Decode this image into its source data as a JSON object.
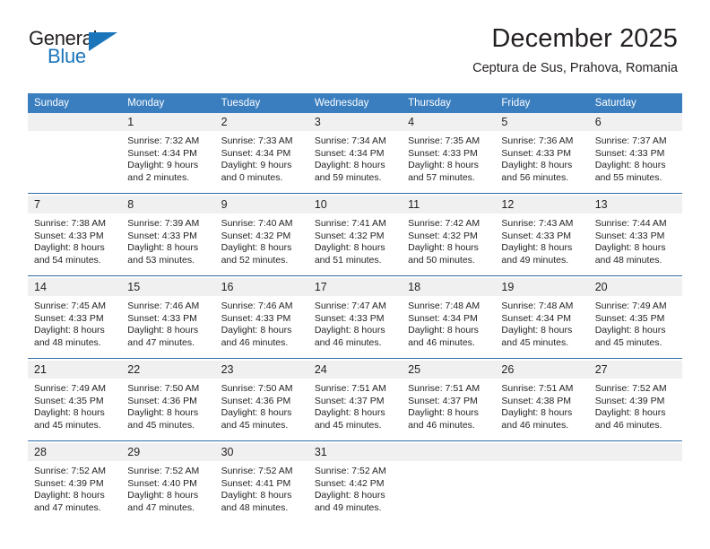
{
  "logo": {
    "word_top": "General",
    "word_bottom": "Blue",
    "triangle_icon": "triangle-icon",
    "brand_color": "#1b75bb"
  },
  "header": {
    "title": "December 2025",
    "subtitle": "Ceptura de Sus, Prahova, Romania"
  },
  "colors": {
    "header_row_bg": "#3a7ebf",
    "header_row_text": "#ffffff",
    "daynum_bg": "#f0f0f0",
    "week_separator": "#2f6da8",
    "body_text": "#231f20"
  },
  "weekday_headers": [
    "Sunday",
    "Monday",
    "Tuesday",
    "Wednesday",
    "Thursday",
    "Friday",
    "Saturday"
  ],
  "weeks": [
    [
      {
        "day": "",
        "sunrise": "",
        "sunset": "",
        "daylight_line1": "",
        "daylight_line2": "",
        "empty": true
      },
      {
        "day": "1",
        "sunrise": "Sunrise: 7:32 AM",
        "sunset": "Sunset: 4:34 PM",
        "daylight_line1": "Daylight: 9 hours",
        "daylight_line2": "and 2 minutes."
      },
      {
        "day": "2",
        "sunrise": "Sunrise: 7:33 AM",
        "sunset": "Sunset: 4:34 PM",
        "daylight_line1": "Daylight: 9 hours",
        "daylight_line2": "and 0 minutes."
      },
      {
        "day": "3",
        "sunrise": "Sunrise: 7:34 AM",
        "sunset": "Sunset: 4:34 PM",
        "daylight_line1": "Daylight: 8 hours",
        "daylight_line2": "and 59 minutes."
      },
      {
        "day": "4",
        "sunrise": "Sunrise: 7:35 AM",
        "sunset": "Sunset: 4:33 PM",
        "daylight_line1": "Daylight: 8 hours",
        "daylight_line2": "and 57 minutes."
      },
      {
        "day": "5",
        "sunrise": "Sunrise: 7:36 AM",
        "sunset": "Sunset: 4:33 PM",
        "daylight_line1": "Daylight: 8 hours",
        "daylight_line2": "and 56 minutes."
      },
      {
        "day": "6",
        "sunrise": "Sunrise: 7:37 AM",
        "sunset": "Sunset: 4:33 PM",
        "daylight_line1": "Daylight: 8 hours",
        "daylight_line2": "and 55 minutes."
      }
    ],
    [
      {
        "day": "7",
        "sunrise": "Sunrise: 7:38 AM",
        "sunset": "Sunset: 4:33 PM",
        "daylight_line1": "Daylight: 8 hours",
        "daylight_line2": "and 54 minutes."
      },
      {
        "day": "8",
        "sunrise": "Sunrise: 7:39 AM",
        "sunset": "Sunset: 4:33 PM",
        "daylight_line1": "Daylight: 8 hours",
        "daylight_line2": "and 53 minutes."
      },
      {
        "day": "9",
        "sunrise": "Sunrise: 7:40 AM",
        "sunset": "Sunset: 4:32 PM",
        "daylight_line1": "Daylight: 8 hours",
        "daylight_line2": "and 52 minutes."
      },
      {
        "day": "10",
        "sunrise": "Sunrise: 7:41 AM",
        "sunset": "Sunset: 4:32 PM",
        "daylight_line1": "Daylight: 8 hours",
        "daylight_line2": "and 51 minutes."
      },
      {
        "day": "11",
        "sunrise": "Sunrise: 7:42 AM",
        "sunset": "Sunset: 4:32 PM",
        "daylight_line1": "Daylight: 8 hours",
        "daylight_line2": "and 50 minutes."
      },
      {
        "day": "12",
        "sunrise": "Sunrise: 7:43 AM",
        "sunset": "Sunset: 4:33 PM",
        "daylight_line1": "Daylight: 8 hours",
        "daylight_line2": "and 49 minutes."
      },
      {
        "day": "13",
        "sunrise": "Sunrise: 7:44 AM",
        "sunset": "Sunset: 4:33 PM",
        "daylight_line1": "Daylight: 8 hours",
        "daylight_line2": "and 48 minutes."
      }
    ],
    [
      {
        "day": "14",
        "sunrise": "Sunrise: 7:45 AM",
        "sunset": "Sunset: 4:33 PM",
        "daylight_line1": "Daylight: 8 hours",
        "daylight_line2": "and 48 minutes."
      },
      {
        "day": "15",
        "sunrise": "Sunrise: 7:46 AM",
        "sunset": "Sunset: 4:33 PM",
        "daylight_line1": "Daylight: 8 hours",
        "daylight_line2": "and 47 minutes."
      },
      {
        "day": "16",
        "sunrise": "Sunrise: 7:46 AM",
        "sunset": "Sunset: 4:33 PM",
        "daylight_line1": "Daylight: 8 hours",
        "daylight_line2": "and 46 minutes."
      },
      {
        "day": "17",
        "sunrise": "Sunrise: 7:47 AM",
        "sunset": "Sunset: 4:33 PM",
        "daylight_line1": "Daylight: 8 hours",
        "daylight_line2": "and 46 minutes."
      },
      {
        "day": "18",
        "sunrise": "Sunrise: 7:48 AM",
        "sunset": "Sunset: 4:34 PM",
        "daylight_line1": "Daylight: 8 hours",
        "daylight_line2": "and 46 minutes."
      },
      {
        "day": "19",
        "sunrise": "Sunrise: 7:48 AM",
        "sunset": "Sunset: 4:34 PM",
        "daylight_line1": "Daylight: 8 hours",
        "daylight_line2": "and 45 minutes."
      },
      {
        "day": "20",
        "sunrise": "Sunrise: 7:49 AM",
        "sunset": "Sunset: 4:35 PM",
        "daylight_line1": "Daylight: 8 hours",
        "daylight_line2": "and 45 minutes."
      }
    ],
    [
      {
        "day": "21",
        "sunrise": "Sunrise: 7:49 AM",
        "sunset": "Sunset: 4:35 PM",
        "daylight_line1": "Daylight: 8 hours",
        "daylight_line2": "and 45 minutes."
      },
      {
        "day": "22",
        "sunrise": "Sunrise: 7:50 AM",
        "sunset": "Sunset: 4:36 PM",
        "daylight_line1": "Daylight: 8 hours",
        "daylight_line2": "and 45 minutes."
      },
      {
        "day": "23",
        "sunrise": "Sunrise: 7:50 AM",
        "sunset": "Sunset: 4:36 PM",
        "daylight_line1": "Daylight: 8 hours",
        "daylight_line2": "and 45 minutes."
      },
      {
        "day": "24",
        "sunrise": "Sunrise: 7:51 AM",
        "sunset": "Sunset: 4:37 PM",
        "daylight_line1": "Daylight: 8 hours",
        "daylight_line2": "and 45 minutes."
      },
      {
        "day": "25",
        "sunrise": "Sunrise: 7:51 AM",
        "sunset": "Sunset: 4:37 PM",
        "daylight_line1": "Daylight: 8 hours",
        "daylight_line2": "and 46 minutes."
      },
      {
        "day": "26",
        "sunrise": "Sunrise: 7:51 AM",
        "sunset": "Sunset: 4:38 PM",
        "daylight_line1": "Daylight: 8 hours",
        "daylight_line2": "and 46 minutes."
      },
      {
        "day": "27",
        "sunrise": "Sunrise: 7:52 AM",
        "sunset": "Sunset: 4:39 PM",
        "daylight_line1": "Daylight: 8 hours",
        "daylight_line2": "and 46 minutes."
      }
    ],
    [
      {
        "day": "28",
        "sunrise": "Sunrise: 7:52 AM",
        "sunset": "Sunset: 4:39 PM",
        "daylight_line1": "Daylight: 8 hours",
        "daylight_line2": "and 47 minutes."
      },
      {
        "day": "29",
        "sunrise": "Sunrise: 7:52 AM",
        "sunset": "Sunset: 4:40 PM",
        "daylight_line1": "Daylight: 8 hours",
        "daylight_line2": "and 47 minutes."
      },
      {
        "day": "30",
        "sunrise": "Sunrise: 7:52 AM",
        "sunset": "Sunset: 4:41 PM",
        "daylight_line1": "Daylight: 8 hours",
        "daylight_line2": "and 48 minutes."
      },
      {
        "day": "31",
        "sunrise": "Sunrise: 7:52 AM",
        "sunset": "Sunset: 4:42 PM",
        "daylight_line1": "Daylight: 8 hours",
        "daylight_line2": "and 49 minutes."
      },
      {
        "day": "",
        "sunrise": "",
        "sunset": "",
        "daylight_line1": "",
        "daylight_line2": "",
        "empty": true
      },
      {
        "day": "",
        "sunrise": "",
        "sunset": "",
        "daylight_line1": "",
        "daylight_line2": "",
        "empty": true
      },
      {
        "day": "",
        "sunrise": "",
        "sunset": "",
        "daylight_line1": "",
        "daylight_line2": "",
        "empty": true
      }
    ]
  ]
}
